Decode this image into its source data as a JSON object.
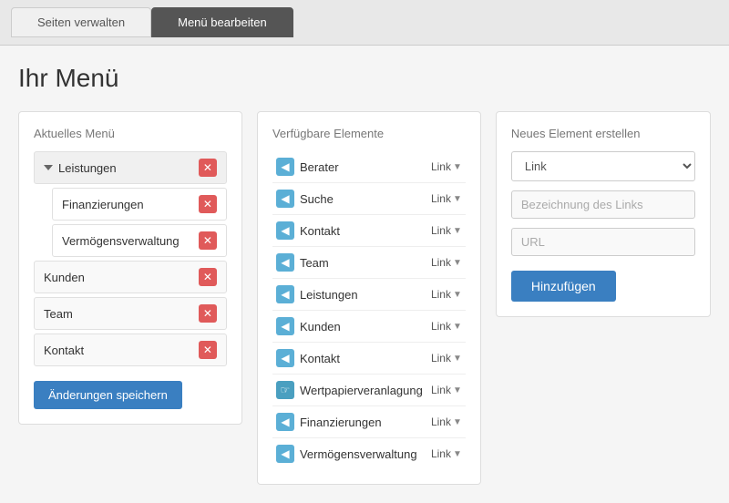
{
  "tabs": [
    {
      "label": "Seiten verwalten",
      "active": false
    },
    {
      "label": "Menü bearbeiten",
      "active": true
    }
  ],
  "page": {
    "title": "Ihr Menü"
  },
  "current_menu": {
    "title": "Aktuelles Menü",
    "items": [
      {
        "label": "Leistungen",
        "type": "parent",
        "hasArrow": true
      },
      {
        "label": "Finanzierungen",
        "type": "child"
      },
      {
        "label": "Vermögensverwaltung",
        "type": "child"
      },
      {
        "label": "Kunden",
        "type": "top"
      },
      {
        "label": "Team",
        "type": "top"
      },
      {
        "label": "Kontakt",
        "type": "top"
      }
    ],
    "save_label": "Änderungen speichern"
  },
  "available": {
    "title": "Verfügbare Elemente",
    "items": [
      {
        "label": "Berater",
        "link": "Link"
      },
      {
        "label": "Suche",
        "link": "Link"
      },
      {
        "label": "Kontakt",
        "link": "Link"
      },
      {
        "label": "Team",
        "link": "Link"
      },
      {
        "label": "Leistungen",
        "link": "Link"
      },
      {
        "label": "Kunden",
        "link": "Link"
      },
      {
        "label": "Kontakt",
        "link": "Link"
      },
      {
        "label": "Wertpapierveranlagung",
        "link": "Link"
      },
      {
        "label": "Finanzierungen",
        "link": "Link"
      },
      {
        "label": "Vermögensverwaltung",
        "link": "Link"
      }
    ]
  },
  "new_element": {
    "title": "Neues Element erstellen",
    "type_label": "Link",
    "name_placeholder": "Bezeichnung des Links",
    "url_placeholder": "URL",
    "add_label": "Hinzufügen"
  }
}
